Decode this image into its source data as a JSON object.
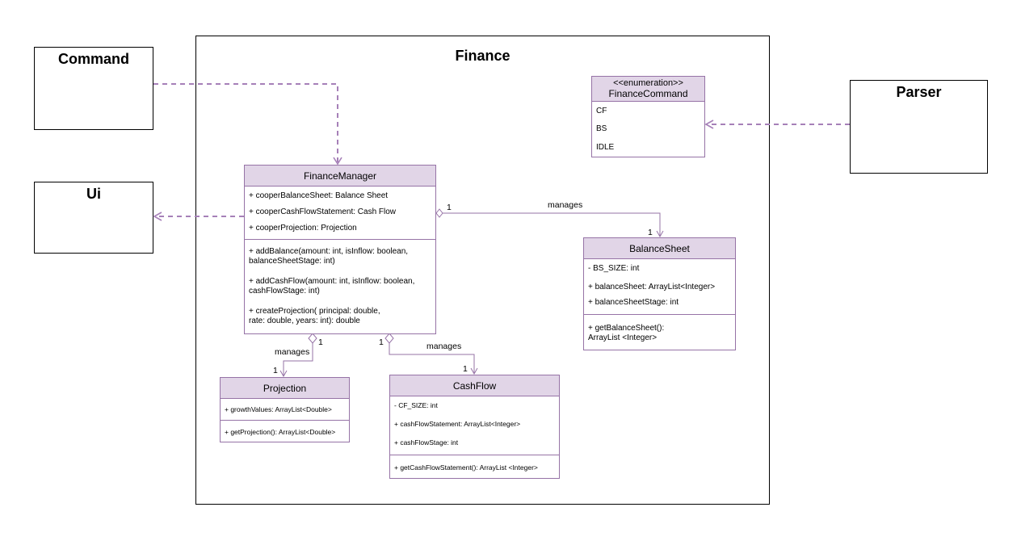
{
  "diagram": {
    "package": {
      "title": "Finance"
    },
    "external": {
      "command": {
        "title": "Command"
      },
      "ui": {
        "title": "Ui"
      },
      "parser": {
        "title": "Parser"
      }
    },
    "classes": {
      "finance_manager": {
        "name": "FinanceManager",
        "attributes": [
          "+ cooperBalanceSheet: Balance Sheet",
          "+ cooperCashFlowStatement: Cash Flow",
          "+ cooperProjection: Projection"
        ],
        "methods": [
          "+ addBalance(amount: int,  isInflow: boolean, balanceSheetStage: int)",
          "+ addCashFlow(amount: int, isInflow: boolean, cashFlowStage: int)",
          "+ createProjection( principal: double, rate: double, years: int): double"
        ]
      },
      "finance_command": {
        "stereotype": "<<enumeration>>",
        "name": "FinanceCommand",
        "values": [
          "CF",
          "BS",
          "IDLE"
        ]
      },
      "balance_sheet": {
        "name": "BalanceSheet",
        "attributes": [
          "- BS_SIZE: int",
          "+ balanceSheet: ArrayList<Integer>",
          "+ balanceSheetStage: int"
        ],
        "methods": [
          "+ getBalanceSheet(): ArrayList <Integer>"
        ]
      },
      "projection": {
        "name": "Projection",
        "attributes": [
          "+ growthValues: ArrayList<Double>"
        ],
        "methods": [
          "+ getProjection(): ArrayList<Double>"
        ]
      },
      "cash_flow": {
        "name": "CashFlow",
        "attributes": [
          "- CF_SIZE: int",
          "+ cashFlowStatement: ArrayList<Integer>",
          "+ cashFlowStage: int"
        ],
        "methods": [
          "+ getCashFlowStatement(): ArrayList <Integer>"
        ]
      }
    },
    "relations": {
      "fm_balance_sheet": {
        "label": "manages",
        "source_mult": "1",
        "target_mult": "1"
      },
      "fm_projection": {
        "label": "manages",
        "source_mult": "1",
        "target_mult": "1"
      },
      "fm_cash_flow": {
        "label": "manages",
        "source_mult": "1",
        "target_mult": "1"
      }
    },
    "colors": {
      "class_border": "#9673a6",
      "class_header_fill": "#e1d5e7",
      "dependency_line": "#a680b8",
      "frame_border": "#000000"
    }
  }
}
